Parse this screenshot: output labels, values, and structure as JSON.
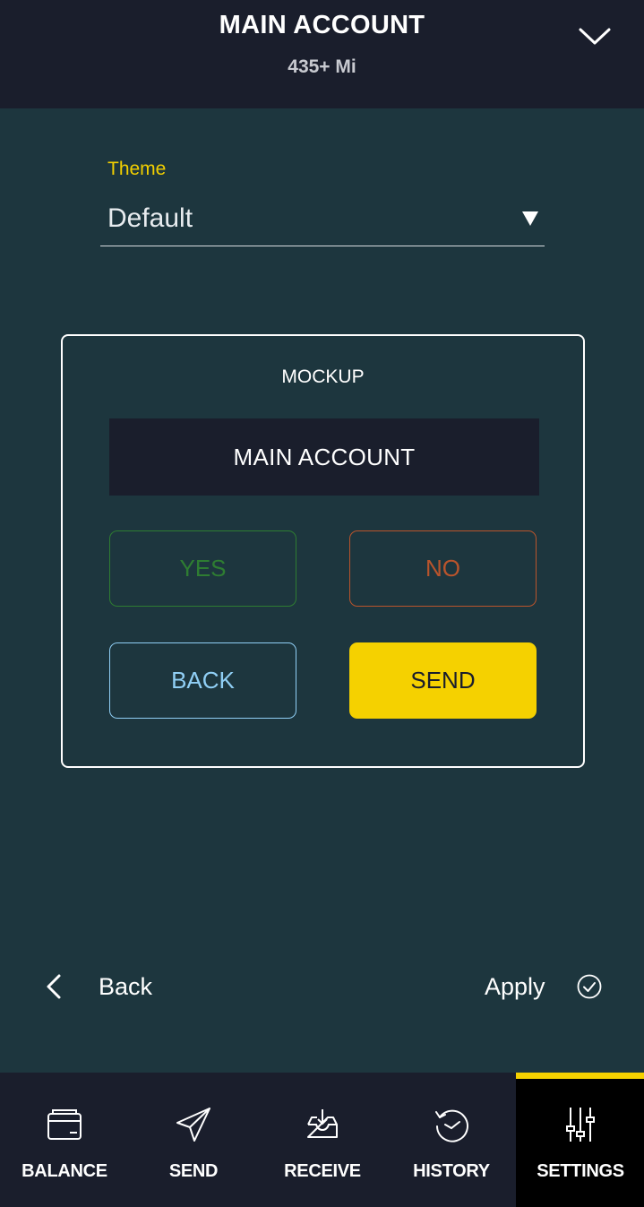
{
  "header": {
    "title": "MAIN ACCOUNT",
    "subtitle": "435+ Mi",
    "toggle_icon": "chevron-down-icon"
  },
  "theme": {
    "label": "Theme",
    "value": "Default",
    "arrow_icon": "dropdown-triangle-icon"
  },
  "mockup": {
    "title": "MOCKUP",
    "bar_label": "MAIN ACCOUNT",
    "yes_label": "YES",
    "no_label": "NO",
    "back_label": "BACK",
    "send_label": "SEND"
  },
  "footer": {
    "back_label": "Back",
    "apply_label": "Apply",
    "back_icon": "chevron-left-icon",
    "apply_icon": "check-circle-icon"
  },
  "tabs": [
    {
      "label": "BALANCE",
      "icon": "wallet-icon",
      "active": false
    },
    {
      "label": "SEND",
      "icon": "paper-plane-icon",
      "active": false
    },
    {
      "label": "RECEIVE",
      "icon": "inbox-download-icon",
      "active": false
    },
    {
      "label": "HISTORY",
      "icon": "history-clock-icon",
      "active": false
    },
    {
      "label": "SETTINGS",
      "icon": "sliders-icon",
      "active": true
    }
  ],
  "colors": {
    "background": "#1d363e",
    "bar": "#1a1e2c",
    "accent": "#f5d100",
    "yes": "#2e7d32",
    "no": "#b9542c",
    "back": "#90cff5"
  }
}
